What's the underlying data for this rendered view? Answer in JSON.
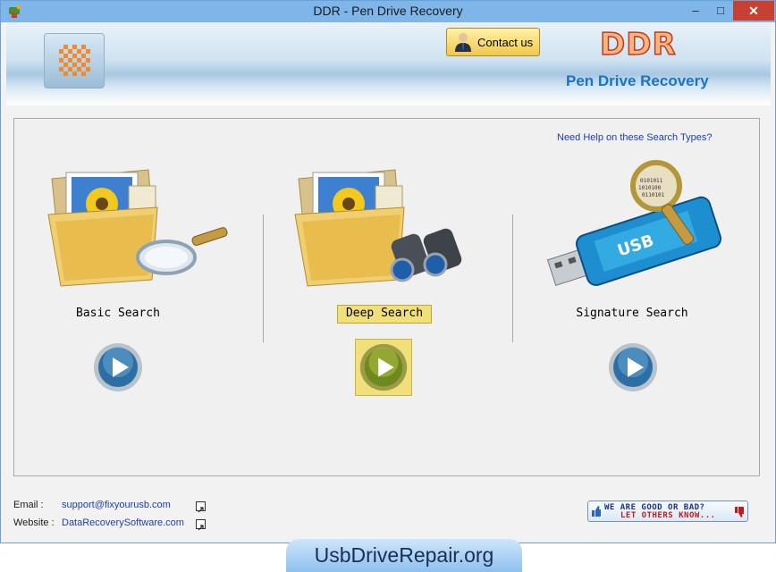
{
  "window": {
    "title": "DDR - Pen Drive Recovery",
    "minimize_label": "–",
    "maximize_label": "□",
    "close_label": "✕"
  },
  "header": {
    "contact_label": "Contact us",
    "brand": "DDR",
    "product": "Pen Drive Recovery"
  },
  "main": {
    "help_link": "Need Help on these Search Types?",
    "options": [
      {
        "label": "Basic Search",
        "selected": false
      },
      {
        "label": "Deep Search",
        "selected": true
      },
      {
        "label": "Signature Search",
        "selected": false
      }
    ],
    "usb_label": "USB"
  },
  "footer": {
    "email_label": "Email :",
    "email_value": "support@fixyourusb.com",
    "website_label": "Website :",
    "website_value": "DataRecoverySoftware.com",
    "feedback_line1": "WE ARE GOOD OR BAD?",
    "feedback_line2": "LET OTHERS KNOW..."
  },
  "banner": {
    "text": "UsbDriveRepair.org"
  },
  "colors": {
    "titlebar": "#7fb6ea",
    "close": "#c84031",
    "brand_fill": "#f5b57e",
    "brand_stroke": "#c23a1f",
    "product": "#1a74c6",
    "link": "#1e3db8",
    "selection": "#f1df7a"
  }
}
